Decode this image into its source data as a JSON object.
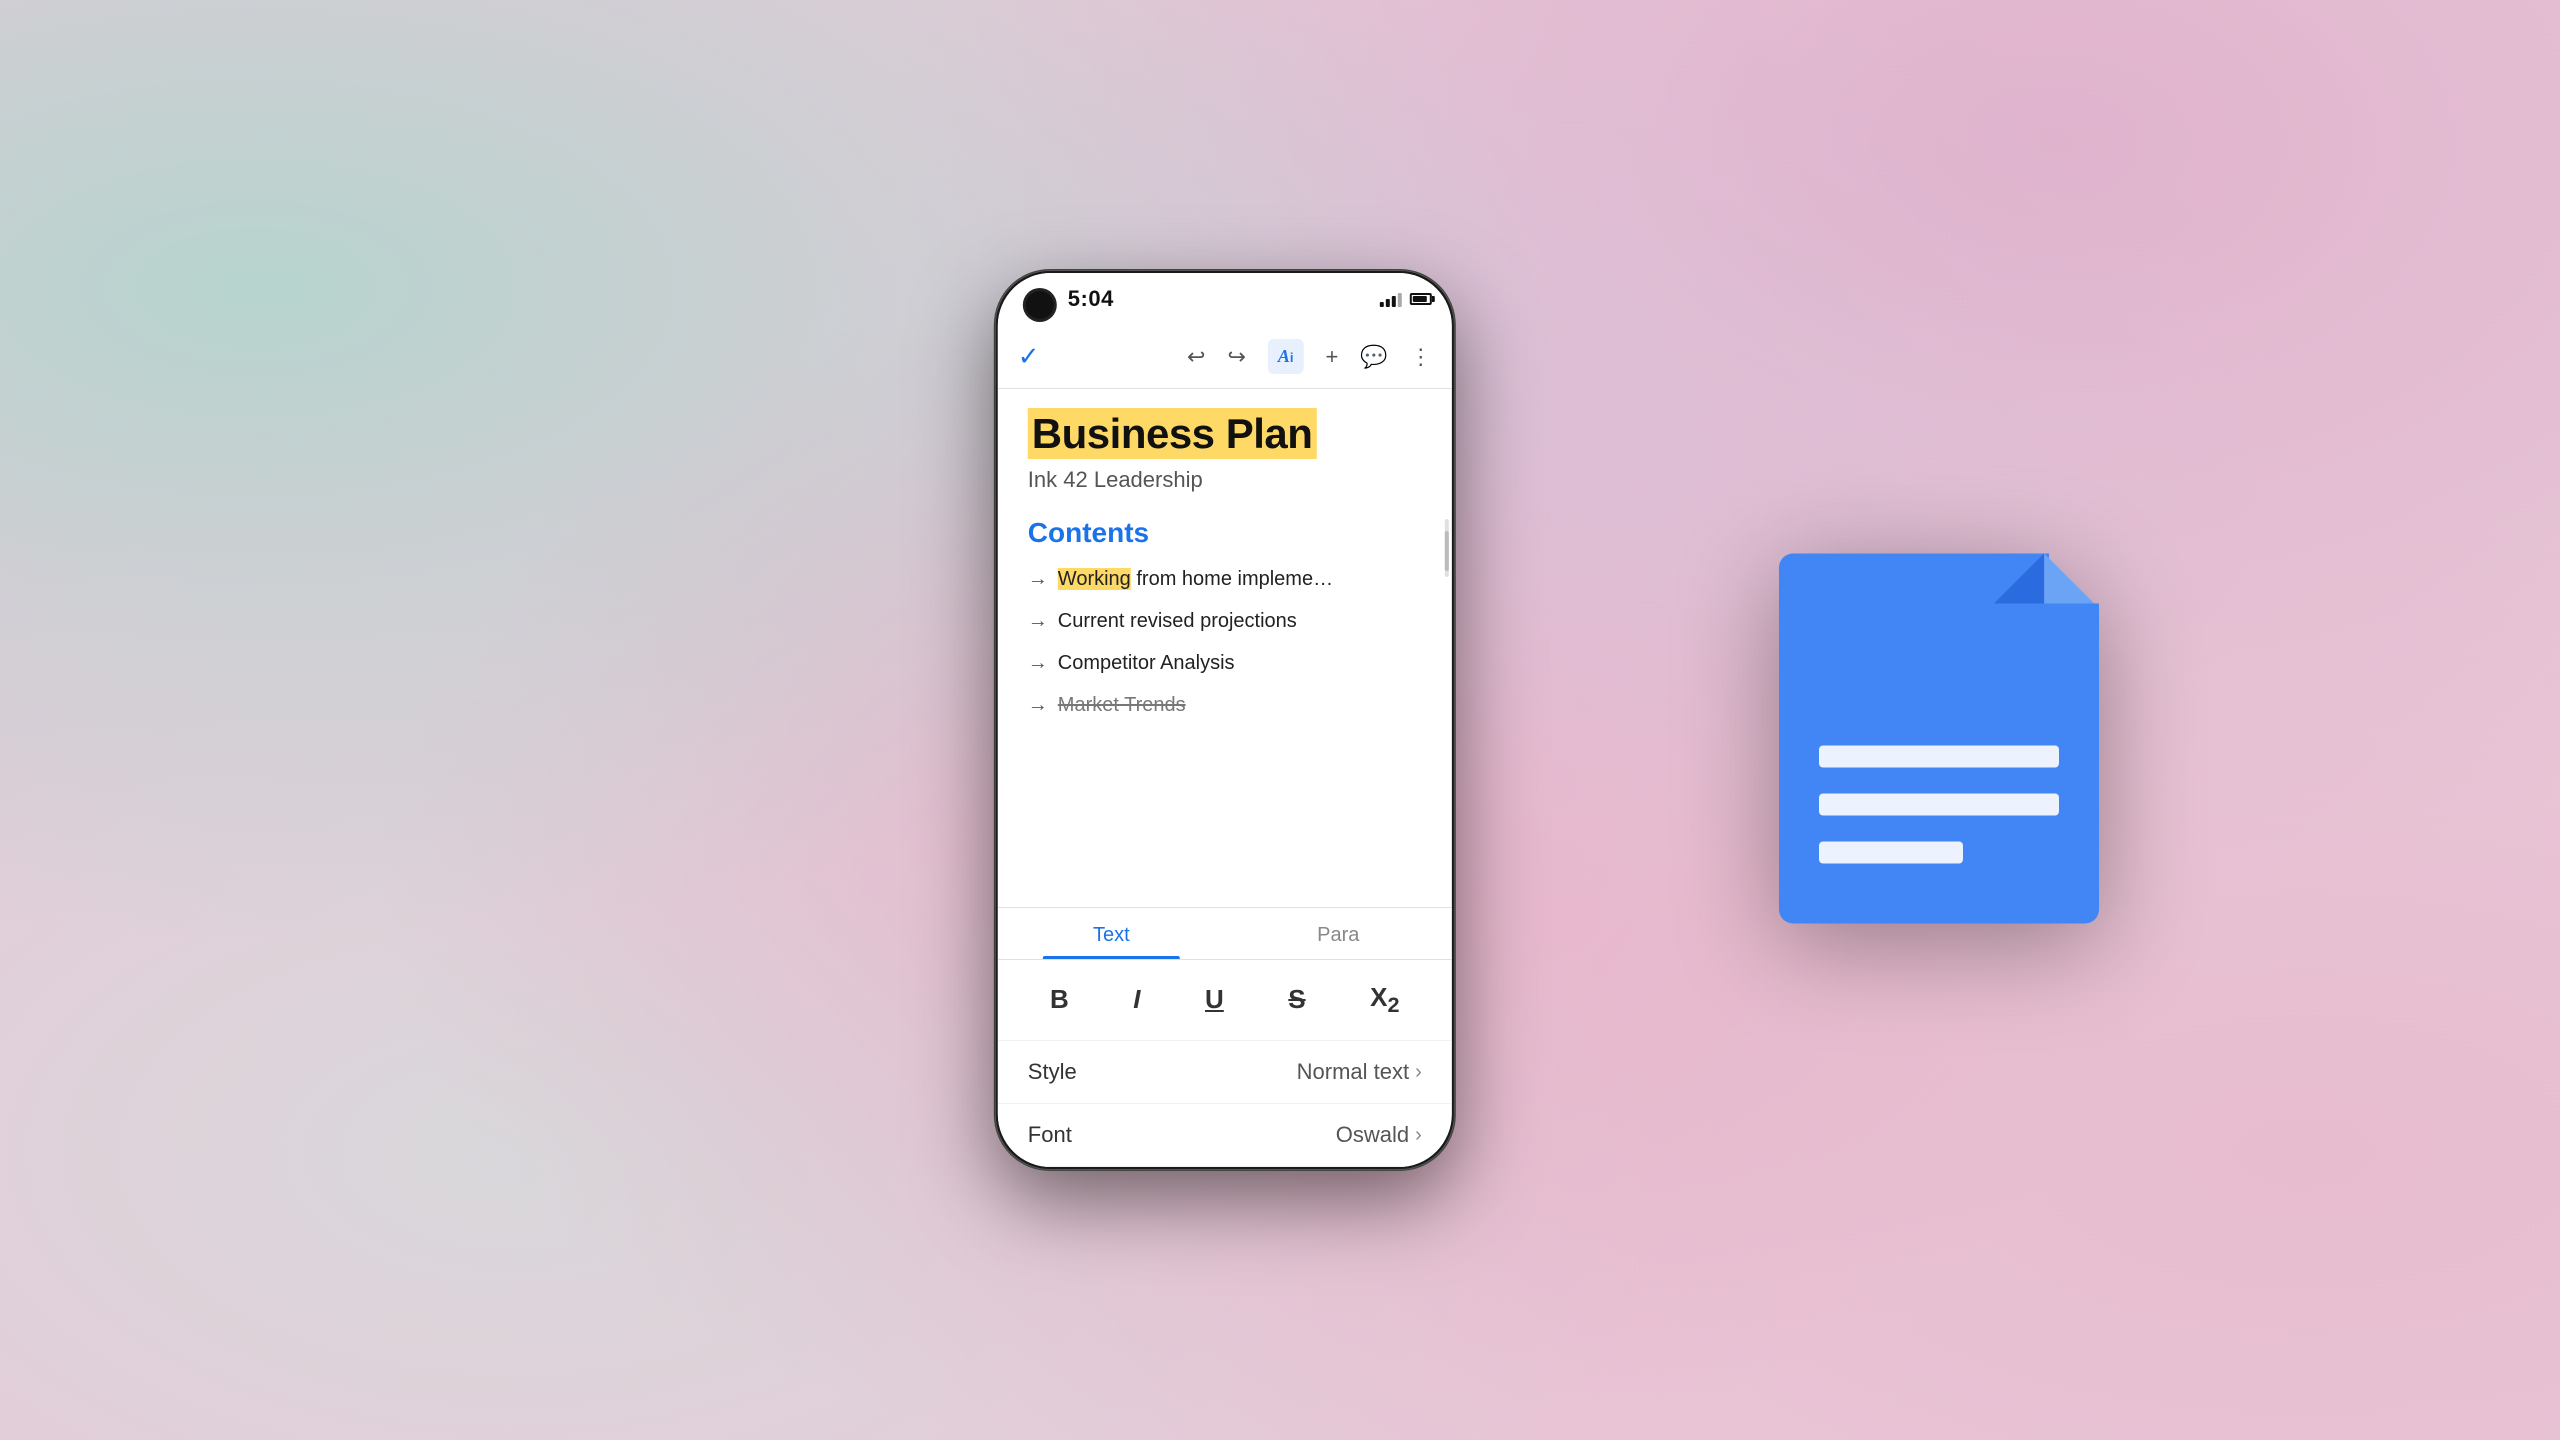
{
  "background": {
    "description": "Soft colorful swirled background"
  },
  "status_bar": {
    "time": "5:04",
    "signal": "signal",
    "battery": "battery"
  },
  "toolbar": {
    "check_icon": "✓",
    "undo_icon": "↩",
    "redo_icon": "↪",
    "text_format_icon": "A",
    "add_icon": "+",
    "comment_icon": "💬",
    "more_icon": "⋮"
  },
  "document": {
    "title": "Business Plan",
    "subtitle": "Ink 42 Leadership",
    "section": "Contents",
    "list_items": [
      {
        "text": "Working from home impleme…",
        "highlight_word": "Working"
      },
      {
        "text": "Current revised projections",
        "highlight_word": ""
      },
      {
        "text": "Competitor Analysis",
        "highlight_word": ""
      },
      {
        "text": "Market Trends",
        "highlight_word": "",
        "strikethrough": true
      }
    ]
  },
  "bottom_panel": {
    "tabs": [
      {
        "label": "Text",
        "active": true
      },
      {
        "label": "Para",
        "active": false
      }
    ],
    "format_buttons": [
      {
        "label": "B",
        "style": "bold"
      },
      {
        "label": "I",
        "style": "italic"
      },
      {
        "label": "U",
        "style": "underline"
      },
      {
        "label": "S",
        "style": "strikethrough"
      },
      {
        "label": "X₂",
        "style": "subscript"
      }
    ],
    "settings": [
      {
        "label": "Style",
        "value": "Normal text"
      },
      {
        "label": "Font",
        "value": "Oswald"
      }
    ]
  },
  "gdocs_icon": {
    "description": "Google Docs document icon in blue"
  }
}
